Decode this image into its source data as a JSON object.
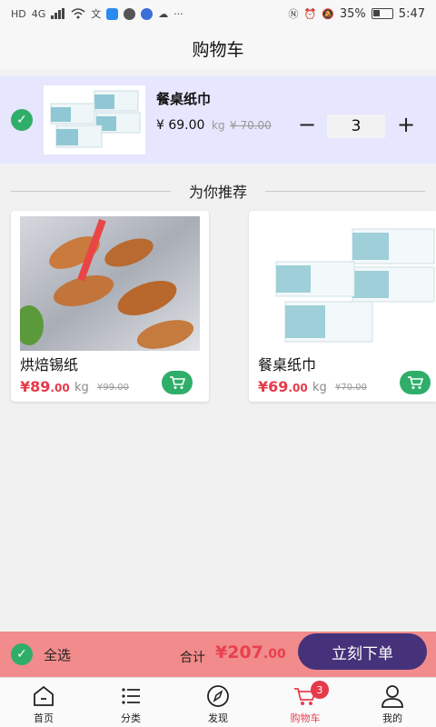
{
  "status_bar": {
    "left_label": "HD",
    "network": "4G",
    "battery": "35%",
    "time": "5:47"
  },
  "header": {
    "title": "购物车"
  },
  "cart": {
    "items": [
      {
        "name": "餐桌纸巾",
        "price": "¥ 69.00",
        "unit": "kg",
        "old_price": "¥ 70.00",
        "quantity": "3",
        "minus_label": "−",
        "plus_label": "+"
      }
    ]
  },
  "recommend": {
    "title": "为你推荐",
    "products": [
      {
        "name": "烘焙锡纸",
        "price_main": "¥89",
        "price_decimal": ".00",
        "unit": "kg",
        "old_price": "¥99.00"
      },
      {
        "name": "餐桌纸巾",
        "price_main": "¥69",
        "price_decimal": ".00",
        "unit": "kg",
        "old_price": "¥70.00"
      }
    ]
  },
  "checkout": {
    "select_all": "全选",
    "total_label": "合计",
    "total_main": "¥207",
    "total_decimal": ".00",
    "order_button": "立刻下单"
  },
  "tabbar": {
    "tabs": [
      {
        "label": "首页",
        "icon": "home-icon"
      },
      {
        "label": "分类",
        "icon": "list-icon"
      },
      {
        "label": "发现",
        "icon": "compass-icon"
      },
      {
        "label": "购物车",
        "icon": "cart-icon",
        "badge": "3"
      },
      {
        "label": "我的",
        "icon": "user-icon"
      }
    ]
  },
  "colors": {
    "accent": "#e8404e",
    "check_green": "#2fae6a",
    "order_button": "#45327a",
    "checkout_bar": "#f28b8b",
    "cart_item_bg": "#e6e6ff"
  }
}
